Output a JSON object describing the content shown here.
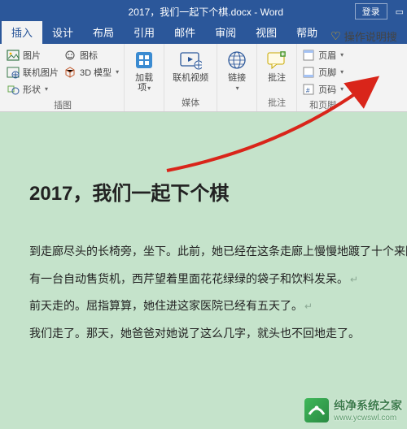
{
  "titlebar": {
    "title": "2017，我们一起下个棋.docx - Word",
    "login": "登录"
  },
  "tabs": {
    "insert": "插入",
    "design": "设计",
    "layout": "布局",
    "references": "引用",
    "mailings": "邮件",
    "review": "审阅",
    "view": "视图",
    "help": "帮助",
    "tell_me": "操作说明搜"
  },
  "ribbon": {
    "pictures": {
      "picture": "图片",
      "online_picture": "联机图片",
      "shapes": "形状"
    },
    "icons_group": {
      "icons": "图标",
      "model3d": "3D 模型"
    },
    "illustrations_label": "插图",
    "addins": {
      "label": "加载\n项",
      "group_label": ""
    },
    "media": {
      "online_video": "联机视频",
      "group_label": "媒体"
    },
    "links": {
      "label": "链接",
      "group_label": ""
    },
    "comments": {
      "label": "批注",
      "group_label": "批注"
    },
    "header_footer": {
      "header": "页眉",
      "footer": "页脚",
      "page_number": "页码",
      "group_label": "和页脚"
    }
  },
  "document": {
    "title": "2017，我们一起下个棋",
    "p1": "到走廊尽头的长椅旁，坐下。此前，她已经在这条走廊上慢慢地踱了十个来回。",
    "p2": "有一台自动售货机，西芹望着里面花花绿绿的袋子和饮料发呆。",
    "p3": "前天走的。屈指算算，她住进这家医院已经有五天了。",
    "p4": "我们走了。那天，她爸爸对她说了这么几字，就头也不回地走了。"
  },
  "watermark": {
    "brand": "纯净系统之家",
    "url": "www.ycwswl.com"
  }
}
